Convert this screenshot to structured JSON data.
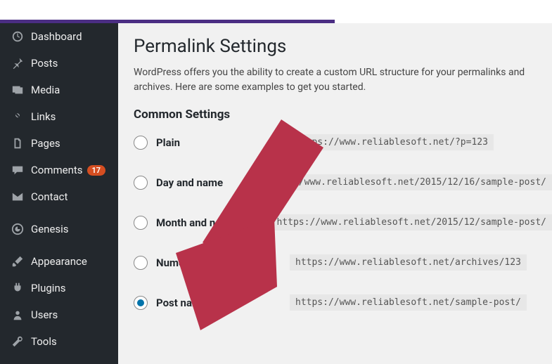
{
  "sidebar": {
    "items": [
      {
        "label": "Dashboard"
      },
      {
        "label": "Posts"
      },
      {
        "label": "Media"
      },
      {
        "label": "Links"
      },
      {
        "label": "Pages"
      },
      {
        "label": "Comments",
        "badge": "17"
      },
      {
        "label": "Contact"
      },
      {
        "label": "Genesis"
      },
      {
        "label": "Appearance"
      },
      {
        "label": "Plugins"
      },
      {
        "label": "Users"
      },
      {
        "label": "Tools"
      }
    ]
  },
  "page": {
    "title": "Permalink Settings",
    "description": "WordPress offers you the ability to create a custom URL structure for your permalinks and archives. Here are some examples to get you started.",
    "section_heading": "Common Settings"
  },
  "options": [
    {
      "label": "Plain",
      "url": "https://www.reliablesoft.net/?p=123",
      "checked": false
    },
    {
      "label": "Day and name",
      "url": "https://www.reliablesoft.net/2015/12/16/sample-post/",
      "checked": false
    },
    {
      "label": "Month and name",
      "url": "https://www.reliablesoft.net/2015/12/sample-post/",
      "checked": false
    },
    {
      "label": "Numeric",
      "url": "https://www.reliablesoft.net/archives/123",
      "checked": false
    },
    {
      "label": "Post name",
      "url": "https://www.reliablesoft.net/sample-post/",
      "checked": true
    }
  ],
  "arrow_color": "#b8324a"
}
